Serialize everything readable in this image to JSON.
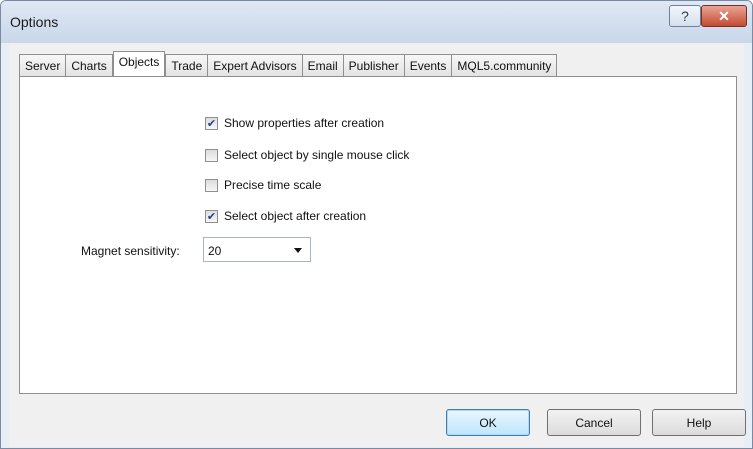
{
  "window": {
    "title": "Options",
    "help_glyph": "?",
    "close_glyph": "✕"
  },
  "tabs": [
    {
      "label": "Server"
    },
    {
      "label": "Charts"
    },
    {
      "label": "Objects",
      "active": true
    },
    {
      "label": "Trade"
    },
    {
      "label": "Expert Advisors"
    },
    {
      "label": "Email"
    },
    {
      "label": "Publisher"
    },
    {
      "label": "Events"
    },
    {
      "label": "MQL5.community"
    }
  ],
  "options": [
    {
      "label": "Show properties after creation",
      "checked": true
    },
    {
      "label": "Select object by single mouse click",
      "checked": false
    },
    {
      "label": "Precise time scale",
      "checked": false
    },
    {
      "label": "Select object after creation",
      "checked": true
    }
  ],
  "magnet": {
    "label": "Magnet sensitivity:",
    "value": "20"
  },
  "buttons": {
    "ok": "OK",
    "cancel": "Cancel",
    "help": "Help"
  },
  "colors": {
    "close_button": "#c44b33",
    "check_mark": "#23408e"
  }
}
